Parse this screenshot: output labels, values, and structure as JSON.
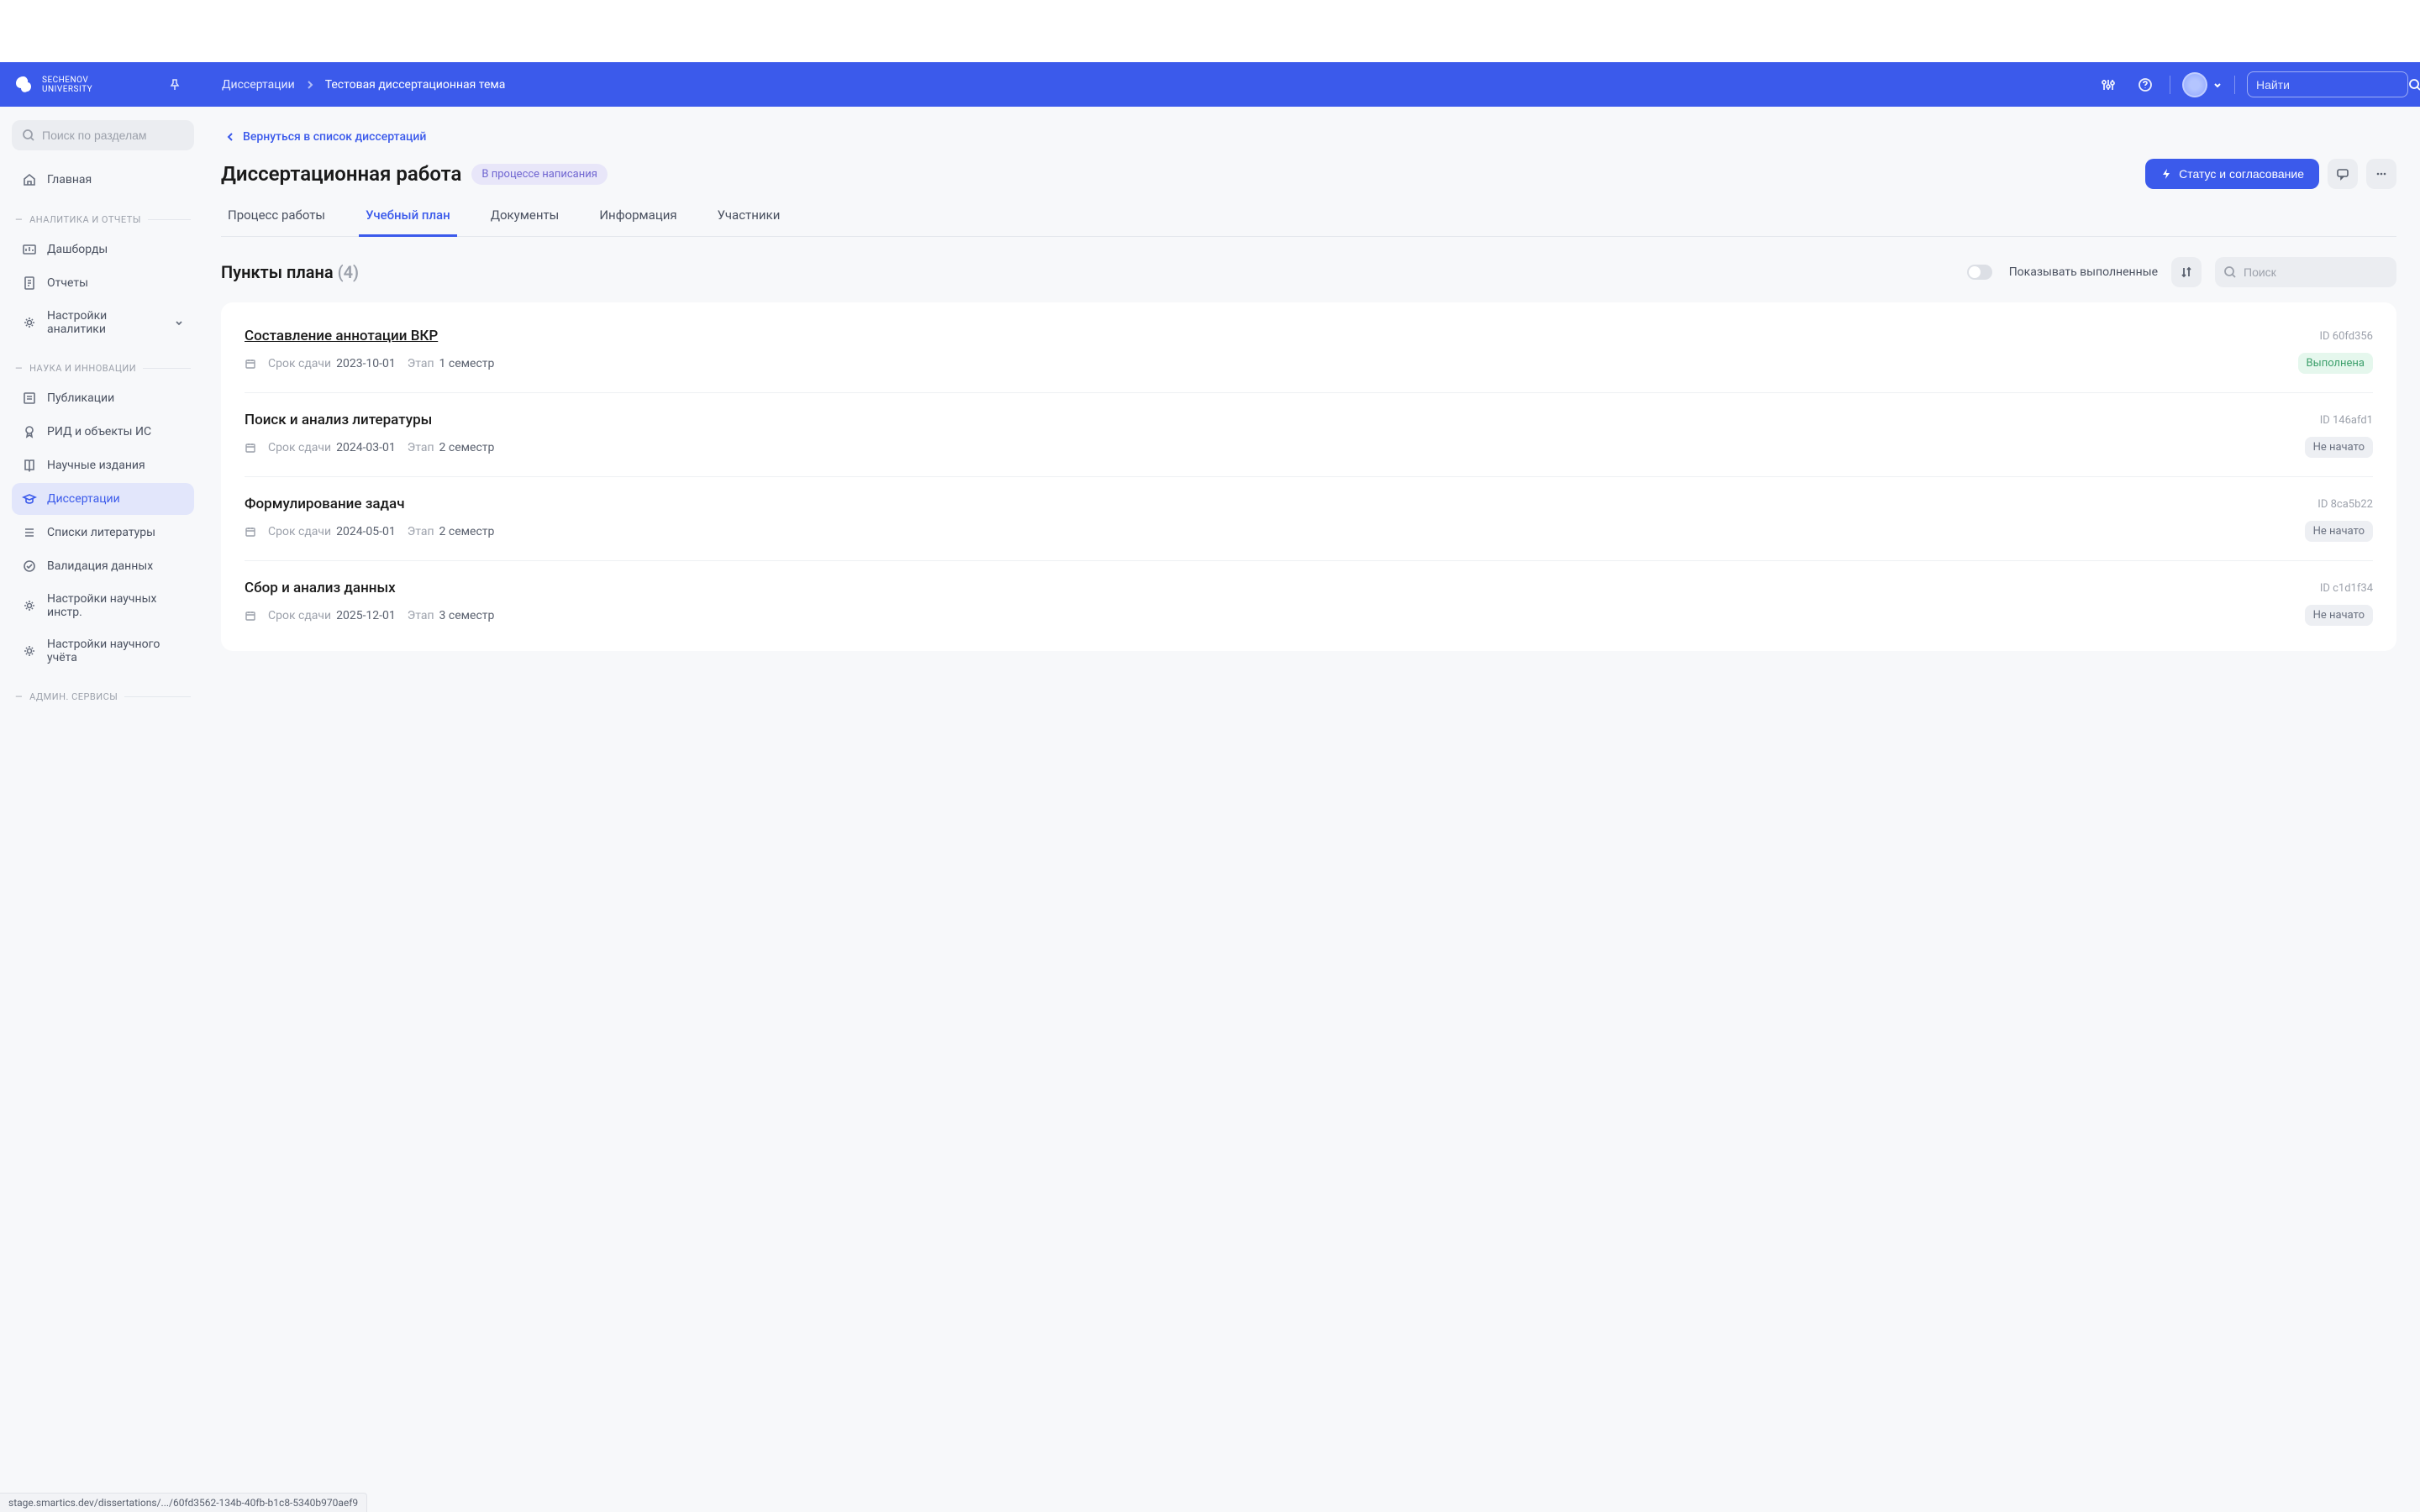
{
  "logo": {
    "line1": "SECHENOV",
    "line2": "UNIVERSITY"
  },
  "breadcrumb": {
    "root": "Диссертации",
    "current": "Тестовая диссертационная тема"
  },
  "header_search_placeholder": "Найти",
  "sidebar": {
    "search_placeholder": "Поиск по разделам",
    "home": "Главная",
    "sections": {
      "analytics": "АНАЛИТИКА И ОТЧЕТЫ",
      "science": "НАУКА И ИННОВАЦИИ",
      "admin": "АДМИН. СЕРВИСЫ"
    },
    "items": {
      "dashboards": "Дашборды",
      "reports": "Отчеты",
      "analytics_settings": "Настройки аналитики",
      "publications": "Публикации",
      "rid": "РИД и объекты ИС",
      "journals": "Научные издания",
      "dissertations": "Диссертации",
      "lit_lists": "Списки литературы",
      "validation": "Валидация данных",
      "sci_tools_settings": "Настройки научных инстр.",
      "sci_account_settings": "Настройки научного учёта"
    }
  },
  "back_link": "Вернуться в список диссертаций",
  "page_title": "Диссертационная работа",
  "status_pill": "В процессе написания",
  "primary_btn": "Статус и согласование",
  "tabs": [
    "Процесс работы",
    "Учебный план",
    "Документы",
    "Информация",
    "Участники"
  ],
  "section": {
    "title": "Пункты плана",
    "count": "(4)",
    "toggle_label": "Показывать выполненные",
    "filter_placeholder": "Поиск"
  },
  "plan_items": [
    {
      "title": "Составление аннотации ВКР",
      "id_prefix": "ID",
      "id": "60fd356",
      "due_label": "Срок сдачи",
      "due": "2023-10-01",
      "stage_label": "Этап",
      "stage": "1 семестр",
      "status": "Выполнена",
      "status_type": "done",
      "underline": true
    },
    {
      "title": "Поиск и анализ литературы",
      "id_prefix": "ID",
      "id": "146afd1",
      "due_label": "Срок сдачи",
      "due": "2024-03-01",
      "stage_label": "Этап",
      "stage": "2 семестр",
      "status": "Не начато",
      "status_type": "not-started"
    },
    {
      "title": "Формулирование задач",
      "id_prefix": "ID",
      "id": "8ca5b22",
      "due_label": "Срок сдачи",
      "due": "2024-05-01",
      "stage_label": "Этап",
      "stage": "2 семестр",
      "status": "Не начато",
      "status_type": "not-started"
    },
    {
      "title": "Сбор и анализ данных",
      "id_prefix": "ID",
      "id": "c1d1f34",
      "due_label": "Срок сдачи",
      "due": "2025-12-01",
      "stage_label": "Этап",
      "stage": "3 семестр",
      "status": "Не начато",
      "status_type": "not-started"
    }
  ],
  "status_bar": "stage.smartics.dev/dissertations/.../60fd3562-134b-40fb-b1c8-5340b970aef9"
}
